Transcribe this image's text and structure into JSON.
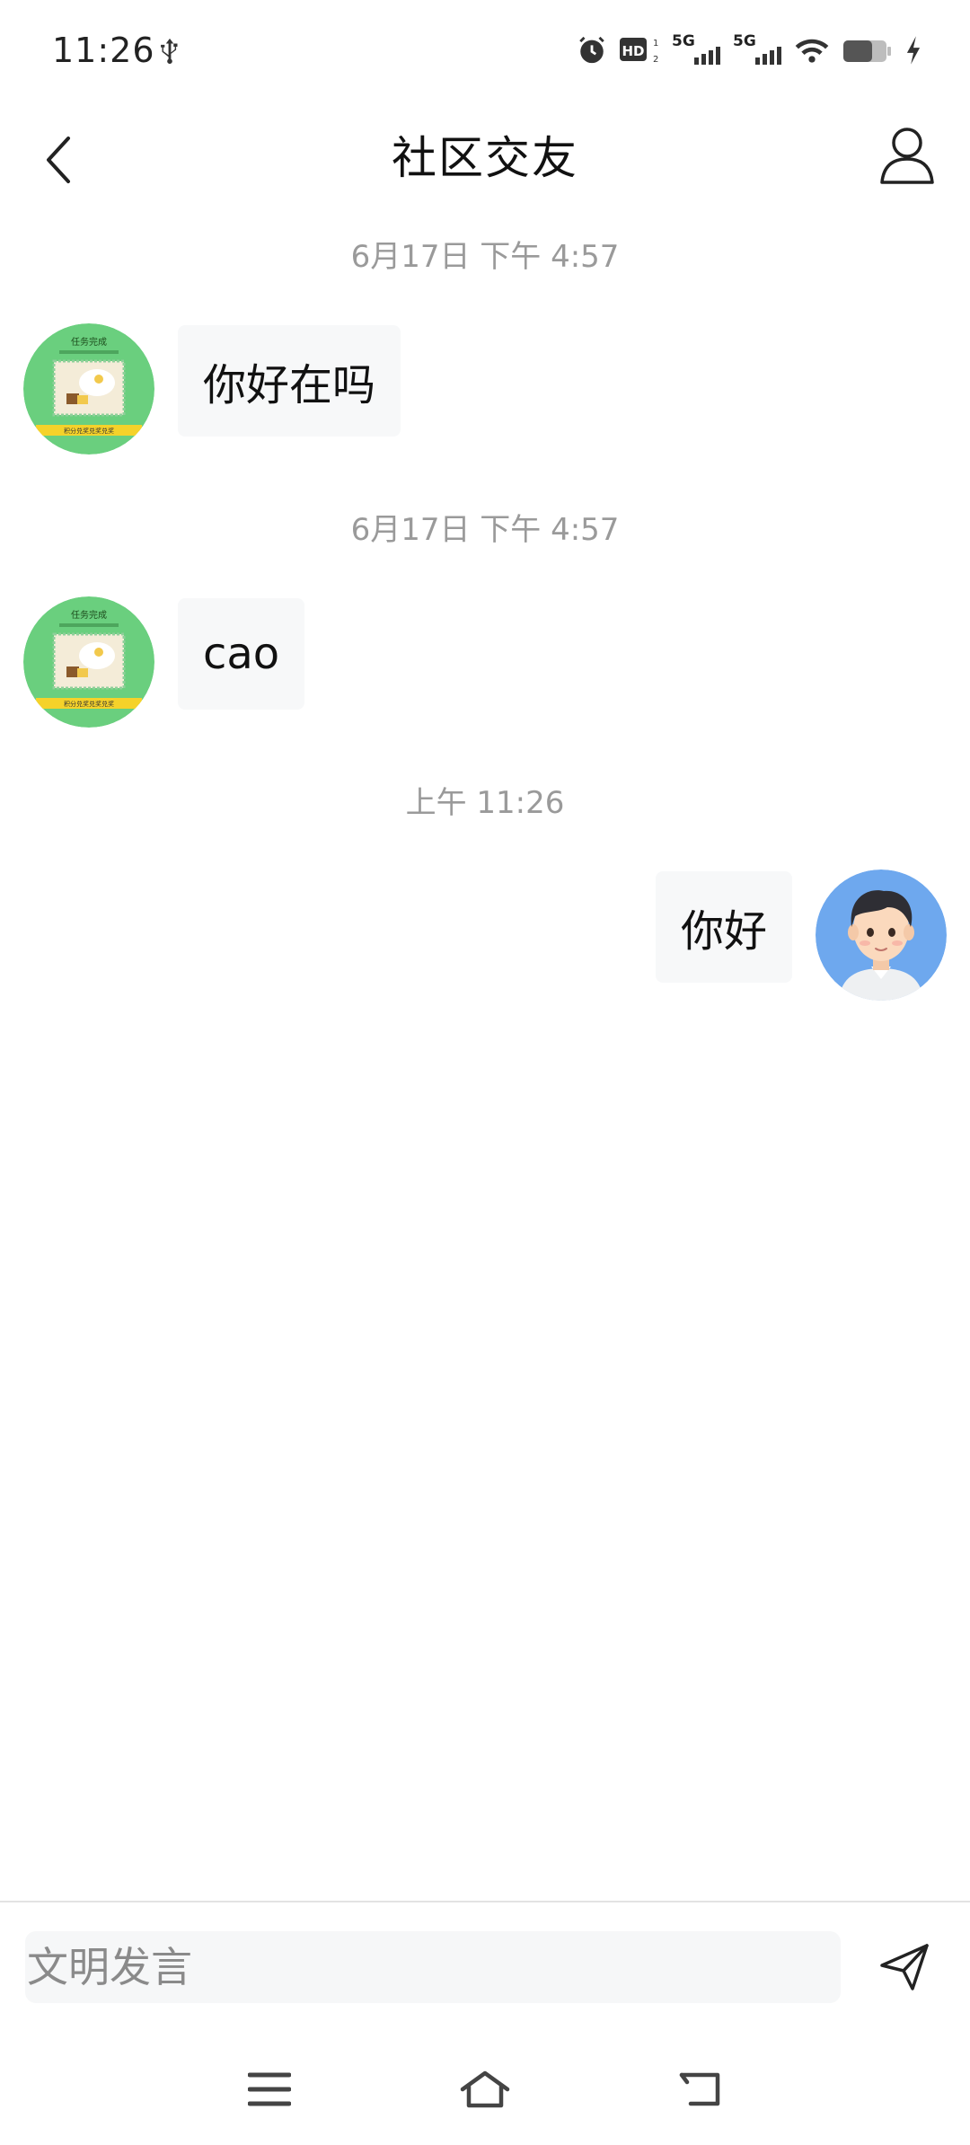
{
  "status_bar": {
    "time": "11:26",
    "left_icons": [
      "usb-icon"
    ],
    "right_icons": [
      "alarm-icon",
      "hd-icon",
      "signal-5g-icon",
      "signal-5g-icon",
      "wifi-icon",
      "battery-icon",
      "charging-icon"
    ],
    "network_label_1": "5G",
    "network_label_2": "5G",
    "hd_label": "HD"
  },
  "header": {
    "title": "社区交友",
    "back_icon": "chevron-left-icon",
    "profile_icon": "person-icon"
  },
  "messages": [
    {
      "timestamp": "6月17日 下午 4:57",
      "side": "left",
      "text": "你好在吗",
      "avatar": "task-complete-avatar"
    },
    {
      "timestamp": "6月17日 下午 4:57",
      "side": "left",
      "text": "cao",
      "avatar": "task-complete-avatar"
    },
    {
      "timestamp": "上午 11:26",
      "side": "right",
      "text": "你好",
      "avatar": "cartoon-man-avatar"
    }
  ],
  "avatar_text": {
    "title": "任务完成",
    "banner": "积分兑奖兑奖兑奖"
  },
  "composer": {
    "placeholder": "文明发言",
    "send_icon": "send-icon"
  },
  "nav_bar": {
    "icons": [
      "menu-icon",
      "home-icon",
      "back-icon"
    ]
  },
  "colors": {
    "green_avatar": "#6acf7e",
    "blue_avatar": "#6ea8ee",
    "bubble": "#f7f8f9",
    "timestamp": "#9a9a9a"
  }
}
